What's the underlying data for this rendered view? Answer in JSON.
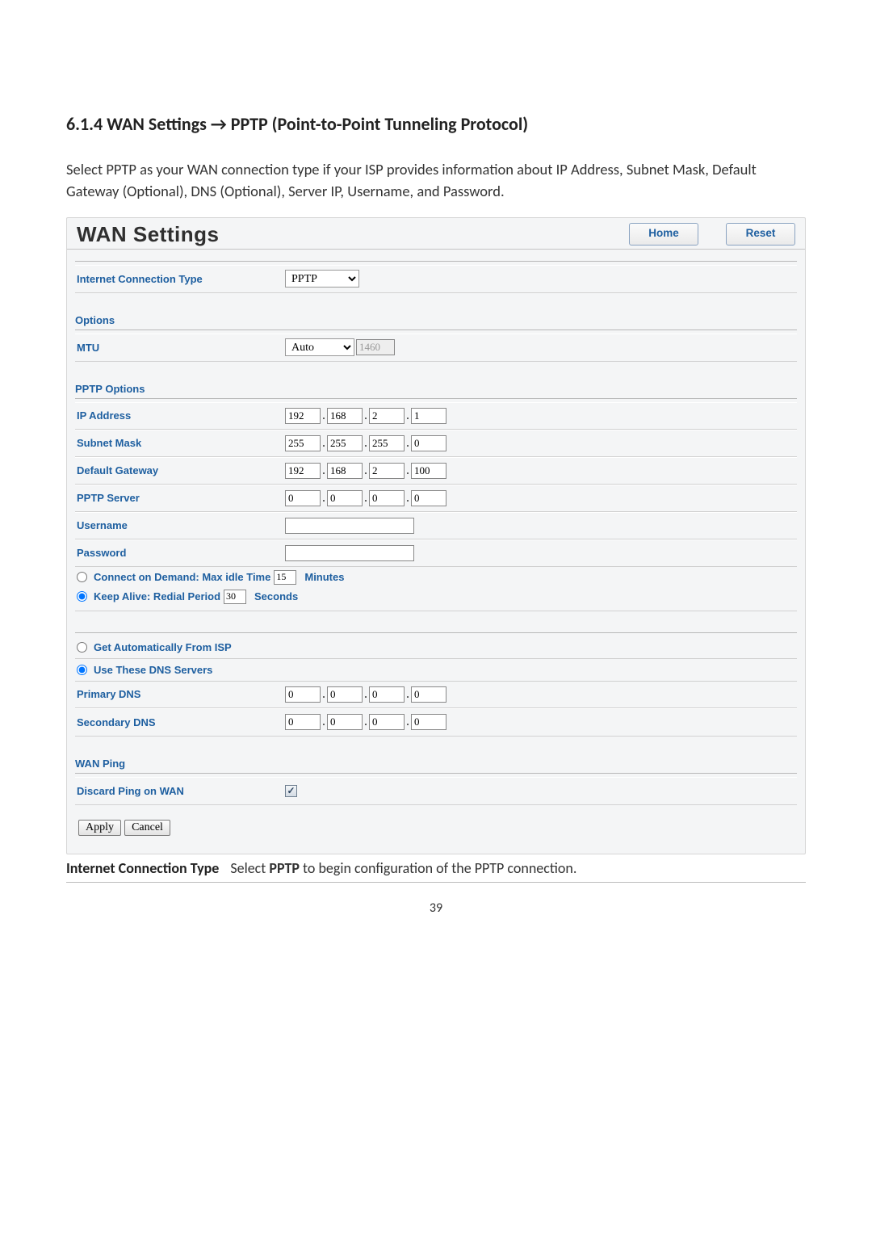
{
  "heading": "6.1.4 WAN Settings → PPTP (Point-to-Point Tunneling Protocol)",
  "intro": "Select PPTP as your WAN connection type if your ISP provides information about IP Address, Subnet Mask, Default Gateway (Optional), DNS (Optional), Server IP, Username, and Password.",
  "panel": {
    "title": "WAN Settings",
    "home": "Home",
    "reset": "Reset"
  },
  "fields": {
    "ict_label": "Internet Connection Type",
    "ict_value": "PPTP",
    "options_head": "Options",
    "mtu_label": "MTU",
    "mtu_mode": "Auto",
    "mtu_value": "1460",
    "pptp_head": "PPTP Options",
    "ip_label": "IP Address",
    "ip": [
      "192",
      "168",
      "2",
      "1"
    ],
    "sm_label": "Subnet Mask",
    "sm": [
      "255",
      "255",
      "255",
      "0"
    ],
    "gw_label": "Default Gateway",
    "gw": [
      "192",
      "168",
      "2",
      "100"
    ],
    "srv_label": "PPTP Server",
    "srv": [
      "0",
      "0",
      "0",
      "0"
    ],
    "user_label": "Username",
    "user_value": "",
    "pass_label": "Password",
    "pass_value": "",
    "cod_label": "Connect on Demand: Max idle Time",
    "cod_value": "15",
    "cod_unit": "Minutes",
    "ka_label": "Keep Alive: Redial Period",
    "ka_value": "30",
    "ka_unit": "Seconds",
    "dns_auto": "Get Automatically From ISP",
    "dns_use": "Use These DNS Servers",
    "pdns_label": "Primary DNS",
    "pdns": [
      "0",
      "0",
      "0",
      "0"
    ],
    "sdns_label": "Secondary DNS",
    "sdns": [
      "0",
      "0",
      "0",
      "0"
    ],
    "wanping_head": "WAN Ping",
    "discard_label": "Discard Ping on WAN",
    "apply": "Apply",
    "cancel": "Cancel"
  },
  "desc": {
    "term": "Internet Connection Type",
    "def_pre": "Select ",
    "def_bold": "PPTP",
    "def_post": " to begin configuration of the PPTP connection."
  },
  "page_number": "39"
}
